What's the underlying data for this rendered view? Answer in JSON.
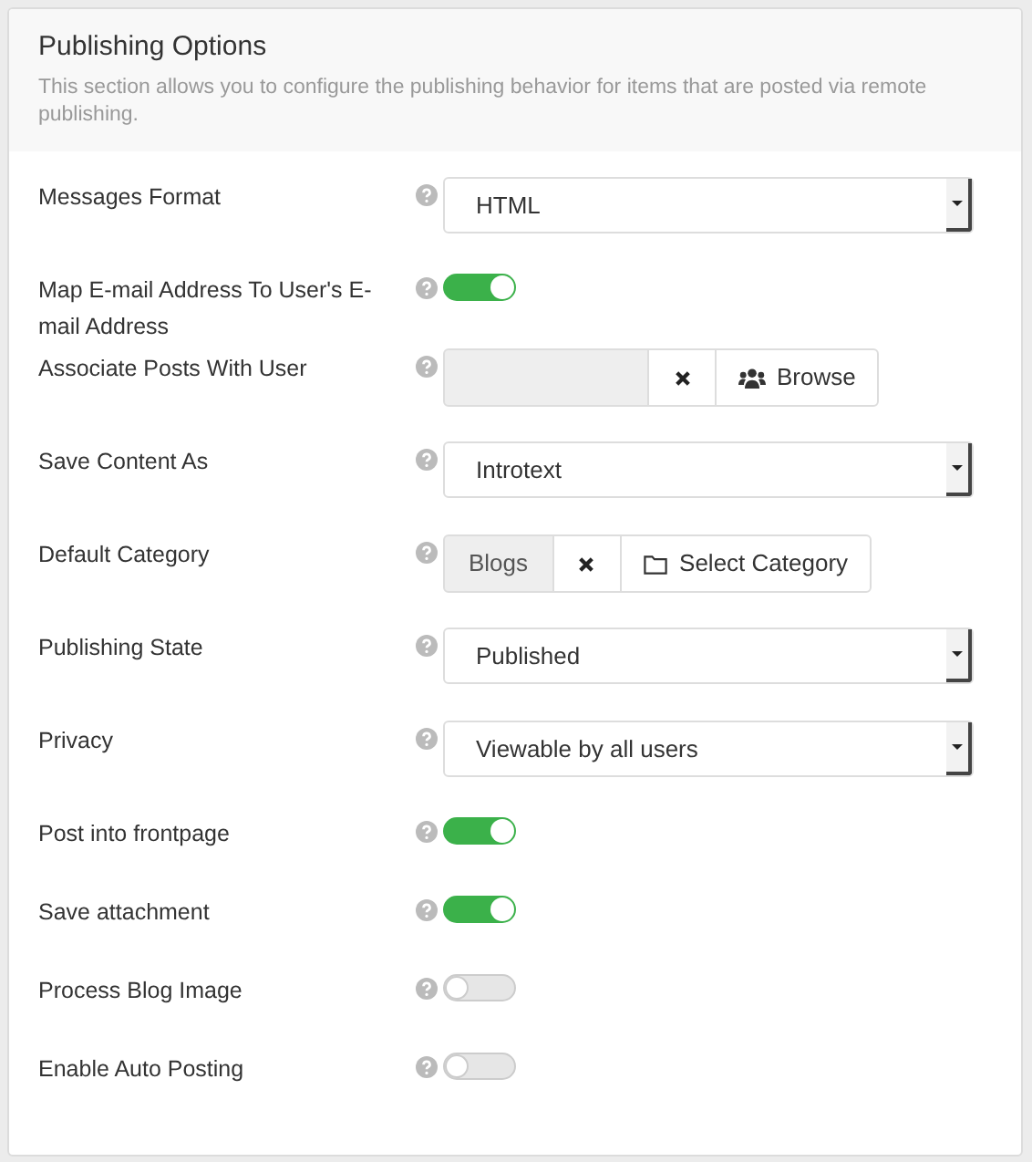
{
  "panel": {
    "title": "Publishing Options",
    "description": "This section allows you to configure the publishing behavior for items that are posted via remote publishing."
  },
  "rows": [
    {
      "label": "Messages Format",
      "kind": "select",
      "value": "HTML"
    },
    {
      "label": "Map E-mail Address To User's E-mail Address",
      "kind": "toggle",
      "on": true
    },
    {
      "label": "Associate Posts With User",
      "kind": "user",
      "button": "Browse"
    },
    {
      "label": "Save Content As",
      "kind": "select",
      "value": "Introtext"
    },
    {
      "label": "Default Category",
      "kind": "category",
      "value": "Blogs",
      "button": "Select Category"
    },
    {
      "label": "Publishing State",
      "kind": "select",
      "value": "Published"
    },
    {
      "label": "Privacy",
      "kind": "select",
      "value": "Viewable by all users"
    },
    {
      "label": "Post into frontpage",
      "kind": "toggle",
      "on": true
    },
    {
      "label": "Save attachment",
      "kind": "toggle",
      "on": true
    },
    {
      "label": "Process Blog Image",
      "kind": "toggle",
      "on": false
    },
    {
      "label": "Enable Auto Posting",
      "kind": "toggle",
      "on": false
    }
  ]
}
